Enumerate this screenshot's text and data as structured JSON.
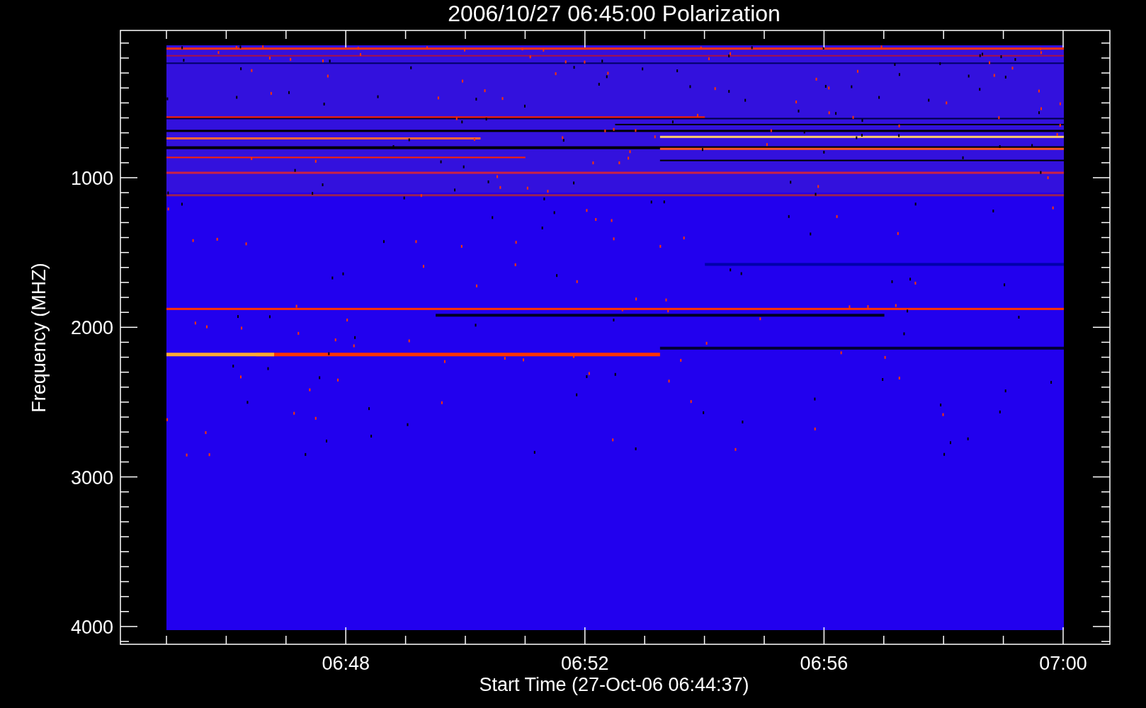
{
  "title": "2006/10/27 06:45:00 Polarization",
  "y_axis": {
    "label": "Frequency (MHZ)",
    "ticks": [
      "1000",
      "2000",
      "3000",
      "4000"
    ]
  },
  "x_axis": {
    "label": "Start Time (27-Oct-06 06:44:37)",
    "ticks": [
      "06:48",
      "06:52",
      "06:56",
      "07:00"
    ]
  }
}
